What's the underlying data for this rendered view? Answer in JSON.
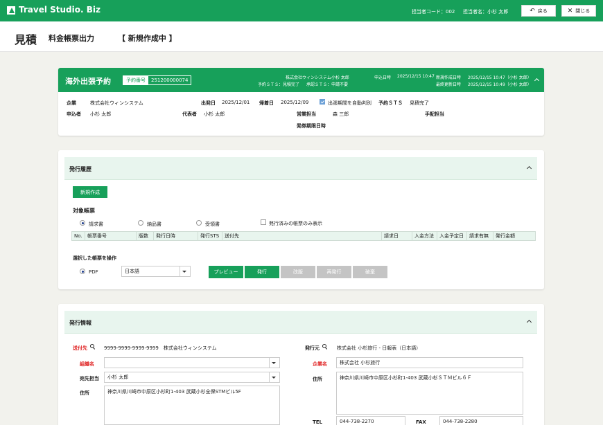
{
  "header": {
    "app_title": "Travel Studio. Biz",
    "staff_code": "担当者コード：002",
    "staff_name": "担当者名：小杉 太郎",
    "back_label": "戻る",
    "close_label": "閉じる"
  },
  "titlebar": {
    "title": "見積",
    "subtitle": "料金帳票出力",
    "status": "【 新規作成中 】"
  },
  "booking": {
    "title": "海外出張予約",
    "no_label": "予約番号",
    "no_value": "251200000074",
    "company_name": "株式会社ウィンシステム",
    "person_name": "小杉 太郎",
    "sts_label": "予約ＳＴＳ：見積完了",
    "approve_sts_label": "承認ＳＴＳ：申請不要",
    "apply_date_label": "申込日時",
    "apply_date": "2025/12/15 10:47",
    "created_label": "新規作成日時",
    "created_value": "2025/12/15 10:47（小杉 太郎）",
    "updated_label": "最終更新日時",
    "updated_value": "2025/12/15 10:49（小杉 太郎）",
    "rows": {
      "company_label": "企業",
      "company_value": "株式会社ウィンシステム",
      "depart_label": "出発日",
      "depart_value": "2025/12/01",
      "return_label": "帰着日",
      "return_value": "2025/12/09",
      "auto_label": "出張期間を自動判別",
      "sts_label": "予約ＳＴＳ",
      "sts_value": "見積完了",
      "applicant_label": "申込者",
      "applicant_value": "小杉 太郎",
      "rep_label": "代表者",
      "rep_value": "小杉 太郎",
      "sales_label": "営業担当",
      "sales_value": "森 三郎",
      "arrange_label": "手配担当",
      "ticket_label": "発券期限日時"
    }
  },
  "history": {
    "title": "発行履歴",
    "new_button": "新規作成",
    "target_label": "対象帳票",
    "radios": [
      "請求書",
      "納品書",
      "受領書"
    ],
    "issued_only": "発行済みの帳票のみ表示",
    "columns": [
      "No.",
      "帳票番号",
      "版数",
      "発行日時",
      "発行STS",
      "送付先",
      "請求日",
      "入金方法",
      "入金予定日",
      "請求有無",
      "発行金額"
    ],
    "operate_label": "選択した帳票を操作",
    "pdf_label": "PDF",
    "language": "日本語",
    "buttons": {
      "preview": "プレビュー",
      "issue": "発行",
      "revise": "改版",
      "reissue": "再発行",
      "discard": "破棄"
    }
  },
  "issue_info": {
    "title": "発行情報",
    "send_to_label": "送付先",
    "send_to_value": "9999-9999-9999-9999　株式会社ウィンシステム",
    "org_label": "組織名",
    "org_value": "",
    "addressee_label": "宛先担当",
    "addressee_value": "小杉 太郎",
    "address_label": "住所",
    "address_value": "神奈川県川崎市中原区小杉町1-403 武蔵小杉全保STMビル5F",
    "issuer_label": "発行元",
    "issuer_value": "株式会社 小杉旅行 - 日報表（日本語）",
    "company_label": "企業名",
    "company_value": "株式会社 小杉旅行",
    "issuer_address_label": "住所",
    "issuer_address_value": "神奈川県川崎市中原区小杉町1-403 武蔵小杉ＳＴＭビル６Ｆ",
    "tel_label": "TEL",
    "tel_value": "044-738-2270",
    "fax_label": "FAX",
    "fax_value": "044-738-2280"
  },
  "colors": {
    "brand": "#17a05a",
    "section_bg": "#e8f5ee",
    "required": "#e02424"
  }
}
